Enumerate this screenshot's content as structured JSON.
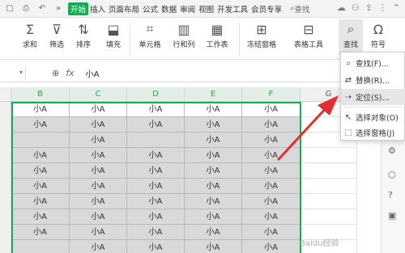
{
  "menubar": {
    "tabs": [
      "开始",
      "插入",
      "页面布局",
      "公式",
      "数据",
      "审阅",
      "视图",
      "开发工具",
      "会员专享"
    ],
    "search_label": "查找"
  },
  "ribbon": {
    "sum": "求和",
    "filter": "筛选",
    "sort": "排序",
    "fill": "填充",
    "cell": "单元格",
    "rowcol": "行和列",
    "worksheet": "工作表",
    "freeze": "冻结窗格",
    "tabletools": "表格工具",
    "find": "查找",
    "symbol": "符号"
  },
  "formula_bar": {
    "fx": "fx",
    "value": "小A"
  },
  "grid": {
    "columns": [
      "B",
      "C",
      "D",
      "E",
      "F",
      "G"
    ],
    "rows": [
      [
        "小A",
        "小A",
        "小A",
        "小A",
        "小A"
      ],
      [
        "小A",
        "小A",
        "小A",
        "小A",
        "小A"
      ],
      [
        "",
        "小A",
        "",
        "小A",
        "小A"
      ],
      [
        "小A",
        "小A",
        "小A",
        "小A",
        "小A"
      ],
      [
        "小A",
        "小A",
        "小A",
        "小A",
        "小A"
      ],
      [
        "小A",
        "小A",
        "小A",
        "小A",
        "小A"
      ],
      [
        "小A",
        "小A",
        "小A",
        "小A",
        "小A"
      ],
      [
        "小A",
        "小A",
        "小A",
        "小A",
        "小A"
      ],
      [
        "小A",
        "小A",
        "小A",
        "小A",
        "小A"
      ],
      [
        "",
        "小A",
        "小A",
        "小A",
        "小A"
      ]
    ]
  },
  "dropdown": {
    "items": [
      "查找(F)...",
      "替换(R)...",
      "定位(S)...",
      "选择对象(O)",
      "选择窗格(J)"
    ]
  },
  "watermark": "Baidu经验",
  "colors": {
    "accent": "#1aaa55",
    "arrow": "#e03030",
    "shade": "#d9d9d9"
  }
}
